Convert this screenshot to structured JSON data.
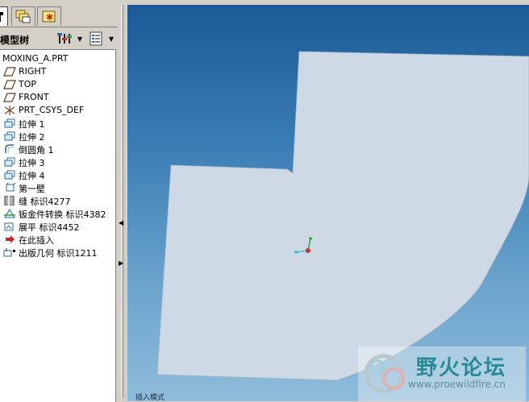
{
  "tabs": [
    {
      "name": "model-tree",
      "icon": "model-tree-tab-icon"
    },
    {
      "name": "folder-browser",
      "icon": "folder-browser-tab-icon"
    },
    {
      "name": "favorites",
      "icon": "favorites-tab-icon"
    }
  ],
  "tree_toolbar": {
    "title": "模型树",
    "tools_icon": "tree-settings-icon",
    "show_icon": "tree-columns-icon"
  },
  "model_tree": {
    "root": "MOXING_A.PRT",
    "items": [
      {
        "label": "RIGHT",
        "icon": "datum-plane-icon"
      },
      {
        "label": "TOP",
        "icon": "datum-plane-icon"
      },
      {
        "label": "FRONT",
        "icon": "datum-plane-icon"
      },
      {
        "label": "PRT_CSYS_DEF",
        "icon": "coordinate-system-icon"
      },
      {
        "label": "拉伸 1",
        "icon": "extrude-icon"
      },
      {
        "label": "拉伸 2",
        "icon": "extrude-icon"
      },
      {
        "label": "倒圆角 1",
        "icon": "round-icon"
      },
      {
        "label": "拉伸 3",
        "icon": "extrude-icon"
      },
      {
        "label": "拉伸 4",
        "icon": "extrude-icon"
      },
      {
        "label": "第一壁",
        "icon": "first-wall-icon"
      },
      {
        "label": "缝 标识4277",
        "icon": "rip-icon"
      },
      {
        "label": "钣金件转换 标识4382",
        "icon": "sheetmetal-convert-icon"
      },
      {
        "label": "展平 标识4452",
        "icon": "flatten-icon"
      },
      {
        "label": "在此插入",
        "icon": "insert-here-arrow-icon"
      },
      {
        "label": "出版几何 标识1211",
        "icon": "publish-geometry-icon"
      }
    ]
  },
  "viewport": {
    "status_hint": "插入模式",
    "background_top": "#1a5a96",
    "background_bottom": "#8fbcda",
    "part_color": "#cdd9e4"
  },
  "watermark": {
    "text_cn": "野火论坛",
    "url": "www.proewildfire.cn"
  }
}
